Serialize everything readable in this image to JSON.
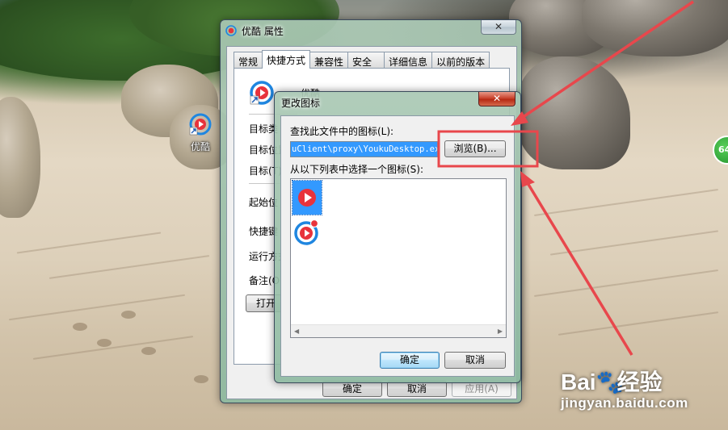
{
  "desktop": {
    "shortcut_label": "优酷",
    "widget_text": "64"
  },
  "props_window": {
    "title": "优酷 属性",
    "tabs": [
      "常规",
      "快捷方式",
      "兼容性",
      "安全",
      "详细信息",
      "以前的版本"
    ],
    "active_tab": "快捷方式",
    "name": "优酷",
    "rows": [
      "目标类",
      "目标位置",
      "目标(T)",
      "起始位",
      "快捷键",
      "运行方式",
      "备注(O)"
    ],
    "open_button": "打开",
    "ok": "确定",
    "cancel": "取消",
    "apply": "应用(A)"
  },
  "icon_dialog": {
    "title": "更改图标",
    "find_label": "查找此文件中的图标(L):",
    "path_value": "uClient\\proxy\\YoukuDesktop.exe",
    "browse_button": "浏览(B)...",
    "list_label": "从以下列表中选择一个图标(S):",
    "ok": "确定",
    "cancel": "取消"
  },
  "annotation": {
    "highlight_color": "#e8474c"
  },
  "watermark": {
    "brand_left": "Bai",
    "brand_right": "经验",
    "url": "jingyan.baidu.com"
  }
}
